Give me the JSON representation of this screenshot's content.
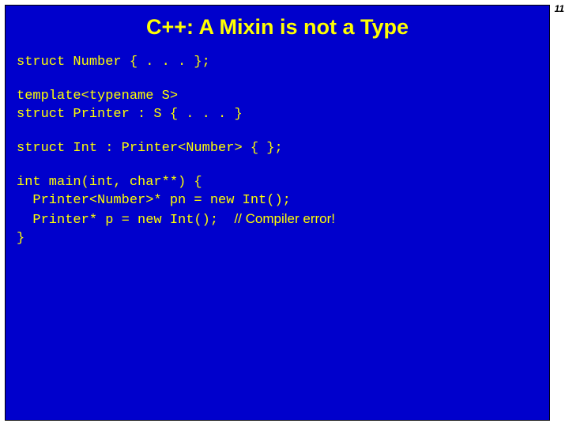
{
  "page_number": "11",
  "title": "C++: A Mixin is not a Type",
  "code": {
    "block1": "struct Number { . . . };",
    "block2": "template<typename S>\nstruct Printer : S { . . . }",
    "block3": "struct Int : Printer<Number> { };",
    "block4_l1": "int main(int, char**) {",
    "block4_l2": "  Printer<Number>* pn = new Int();",
    "block4_l3_code": "  Printer* p = new Int();  ",
    "block4_l3_comment": "// Compiler error!",
    "block4_l4": "}"
  }
}
